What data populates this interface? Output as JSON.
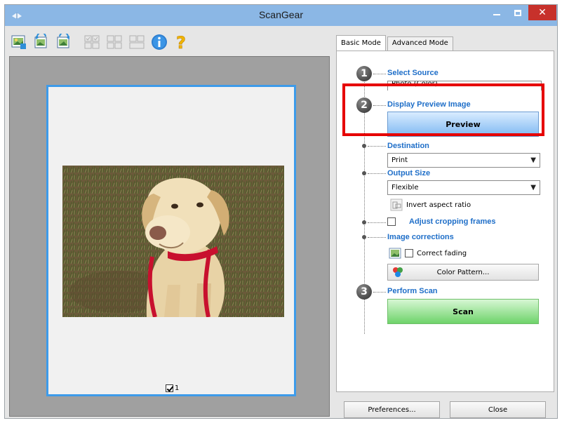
{
  "window": {
    "title": "ScanGear",
    "close_glyph": "✕"
  },
  "toolbar": {
    "icons": [
      "scan-photo-icon",
      "rotate-left-icon",
      "rotate-right-icon",
      "thumbnail-view-icon",
      "select-all-icon",
      "whole-image-icon",
      "info-icon",
      "help-icon"
    ]
  },
  "preview": {
    "frame_number": "1"
  },
  "tabs": {
    "basic": "Basic Mode",
    "advanced": "Advanced Mode"
  },
  "steps": {
    "one": "1",
    "two": "2",
    "three": "3"
  },
  "select_source": {
    "title": "Select Source",
    "value": "Photo (Color)"
  },
  "display_preview": {
    "title": "Display Preview Image",
    "button": "Preview"
  },
  "destination": {
    "title": "Destination",
    "value": "Print"
  },
  "output_size": {
    "title": "Output Size",
    "value": "Flexible",
    "invert_label": "Invert aspect ratio"
  },
  "cropping": {
    "label": "Adjust cropping frames"
  },
  "image_corrections": {
    "title": "Image corrections",
    "correct_fading": "Correct fading",
    "color_pattern": "Color Pattern..."
  },
  "perform_scan": {
    "title": "Perform Scan",
    "button": "Scan"
  },
  "footer": {
    "preferences": "Preferences...",
    "close": "Close"
  },
  "colors": {
    "titlebar": "#8bb7e5",
    "accent": "#1e6ec8",
    "highlight": "#e60000",
    "frame": "#3d9bea"
  }
}
